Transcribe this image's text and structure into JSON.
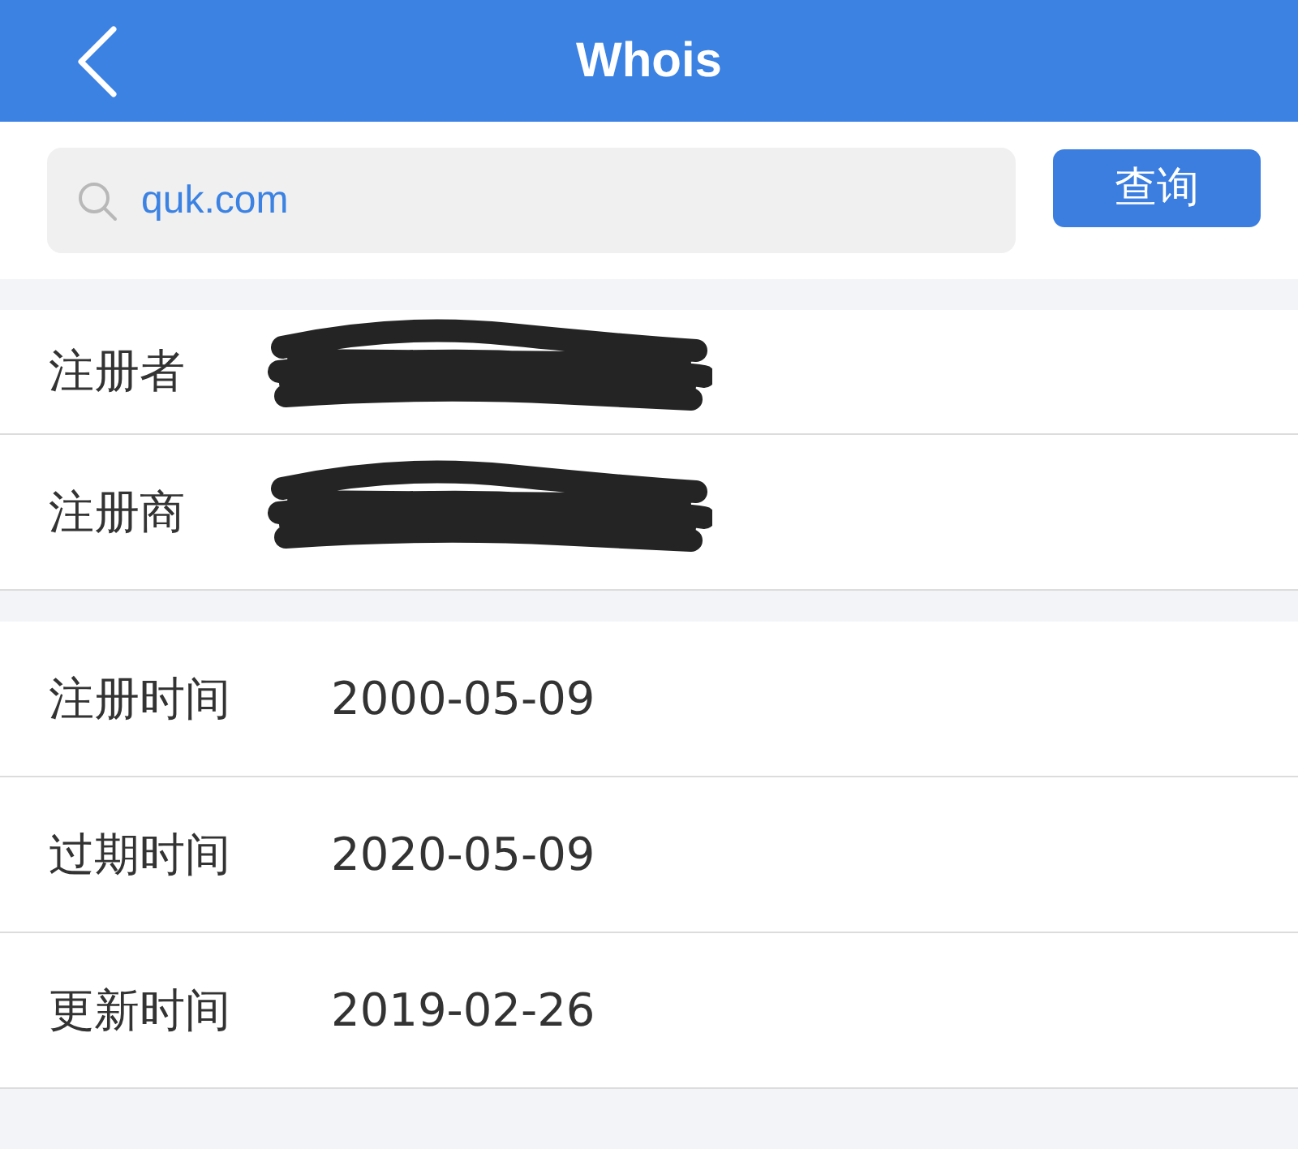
{
  "header": {
    "title": "Whois"
  },
  "search": {
    "value": "quk.com",
    "button": "查询"
  },
  "groups": [
    {
      "rows": [
        {
          "label": "注册者",
          "redacted": true
        },
        {
          "label": "注册商",
          "redacted": true
        }
      ]
    },
    {
      "rows": [
        {
          "label": "注册时间",
          "value": "2000-05-09"
        },
        {
          "label": "过期时间",
          "value": "2020-05-09"
        },
        {
          "label": "更新时间",
          "value": "2019-02-26"
        }
      ]
    }
  ]
}
